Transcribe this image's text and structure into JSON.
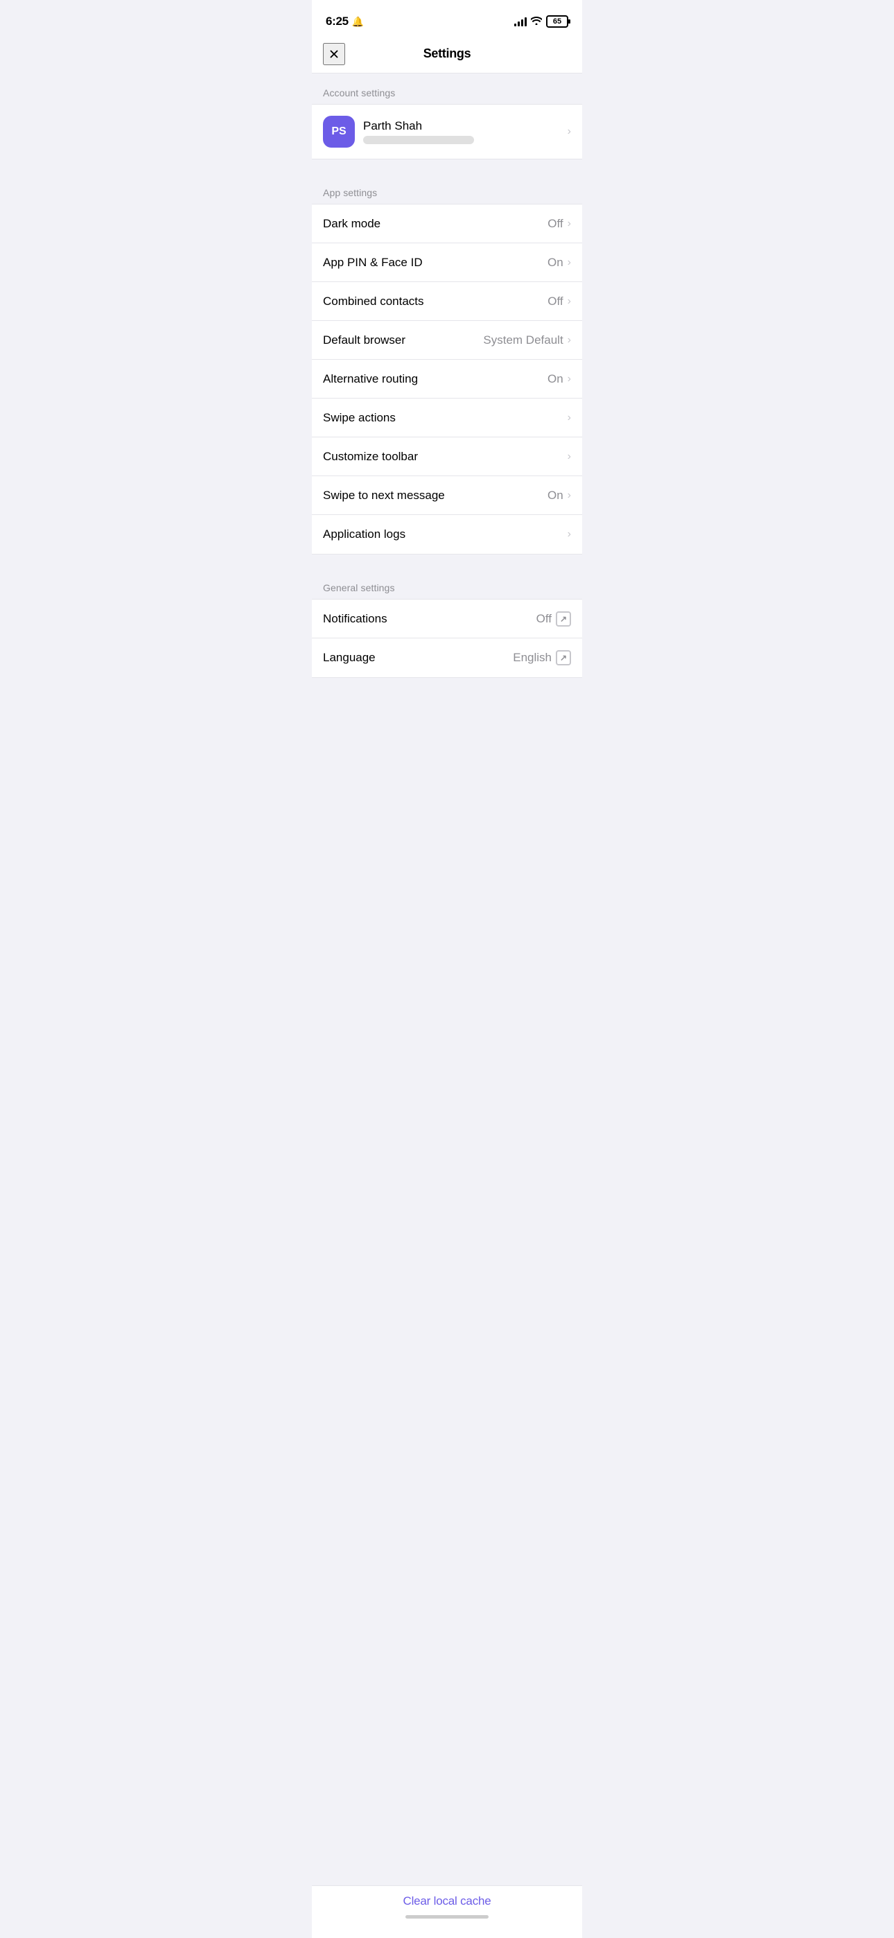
{
  "statusBar": {
    "time": "6:25",
    "battery": "65"
  },
  "header": {
    "title": "Settings",
    "close_label": "Close"
  },
  "sections": {
    "account": {
      "label": "Account settings",
      "user": {
        "initials": "PS",
        "name": "Parth Shah"
      }
    },
    "app": {
      "label": "App settings",
      "items": [
        {
          "id": "dark-mode",
          "label": "Dark mode",
          "value": "Off",
          "type": "chevron"
        },
        {
          "id": "app-pin",
          "label": "App PIN & Face ID",
          "value": "On",
          "type": "chevron"
        },
        {
          "id": "combined-contacts",
          "label": "Combined contacts",
          "value": "Off",
          "type": "chevron"
        },
        {
          "id": "default-browser",
          "label": "Default browser",
          "value": "System Default",
          "type": "chevron"
        },
        {
          "id": "alternative-routing",
          "label": "Alternative routing",
          "value": "On",
          "type": "chevron"
        },
        {
          "id": "swipe-actions",
          "label": "Swipe actions",
          "value": "",
          "type": "chevron"
        },
        {
          "id": "customize-toolbar",
          "label": "Customize toolbar",
          "value": "",
          "type": "chevron"
        },
        {
          "id": "swipe-next",
          "label": "Swipe to next message",
          "value": "On",
          "type": "chevron"
        },
        {
          "id": "app-logs",
          "label": "Application logs",
          "value": "",
          "type": "chevron"
        }
      ]
    },
    "general": {
      "label": "General settings",
      "items": [
        {
          "id": "notifications",
          "label": "Notifications",
          "value": "Off",
          "type": "external"
        },
        {
          "id": "language",
          "label": "Language",
          "value": "English",
          "type": "external"
        }
      ]
    }
  },
  "footer": {
    "clear_cache_label": "Clear local cache"
  }
}
